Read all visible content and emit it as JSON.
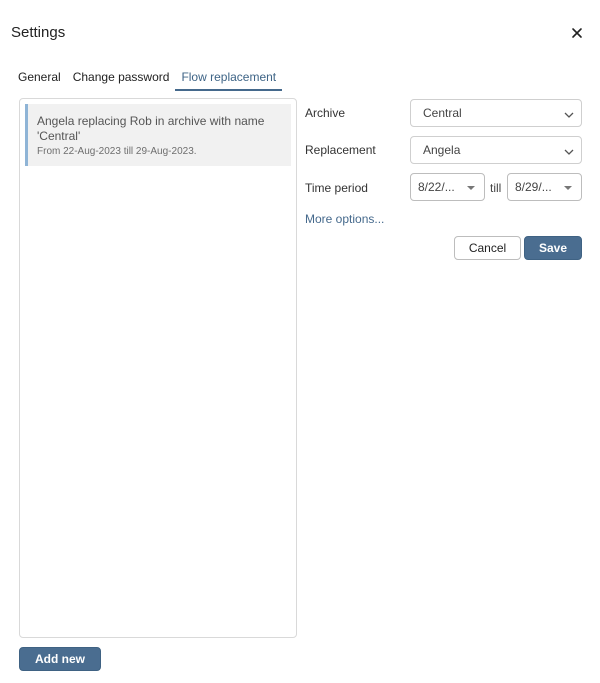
{
  "dialog": {
    "title": "Settings",
    "close_icon": "close-icon"
  },
  "tabs": [
    {
      "label": "General",
      "active": false
    },
    {
      "label": "Change password",
      "active": false
    },
    {
      "label": "Flow replacement",
      "active": true
    }
  ],
  "replacements": [
    {
      "title": "Angela replacing Rob in archive with name 'Central'",
      "period": "From 22-Aug-2023 till 29-Aug-2023.",
      "selected": true
    }
  ],
  "form": {
    "archive_label": "Archive",
    "archive_value": "Central",
    "replacement_label": "Replacement",
    "replacement_value": "Angela",
    "time_period_label": "Time period",
    "date_from": "8/22/...",
    "till_label": "till",
    "date_to": "8/29/...",
    "more_options": "More options..."
  },
  "actions": {
    "cancel_label": "Cancel",
    "save_label": "Save",
    "add_new_label": "Add new"
  },
  "colors": {
    "accent": "#4a6d90",
    "link": "#45698c",
    "selected_item_bg": "#f1f1f1",
    "selected_item_border": "#8fb4d6"
  }
}
